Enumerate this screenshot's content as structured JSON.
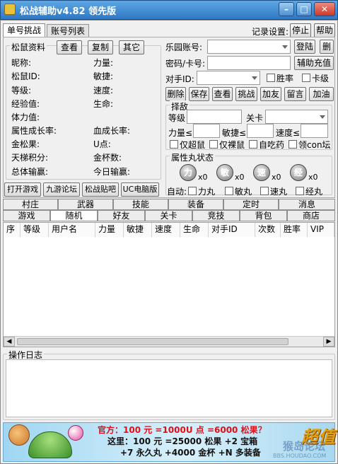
{
  "window": {
    "title": "松战辅助v4.82 领先版",
    "min": "–",
    "max": "□",
    "close": "✕"
  },
  "top_tabs": [
    {
      "label": "单号挑战"
    },
    {
      "label": "账号列表"
    }
  ],
  "record": {
    "label": "记录设置:",
    "stop": "停止",
    "help": "帮助"
  },
  "profile": {
    "group_label": "松鼠资料",
    "view": "查看",
    "copy": "复制",
    "other": "其它",
    "left_fields": [
      "昵称:",
      "松鼠ID:",
      "等级:",
      "经验值:",
      "体力值:",
      "属性成长率:",
      "金松果:",
      "天梯积分:",
      "总体输赢:"
    ],
    "right_fields": [
      "力量:",
      "敏捷:",
      "速度:",
      "生命:",
      "",
      "血成长率:",
      "U点:",
      "金杯数:",
      "今日输赢:"
    ]
  },
  "bottom_buttons": [
    "打开游戏",
    "九游论坛",
    "松战贴吧",
    "UC电脑版"
  ],
  "account": {
    "park_label": "乐园账号:",
    "login": "登陆",
    "delete": "删",
    "pwd_label": "密码/卡号:",
    "recharge": "辅助充值",
    "opponent_label": "对手ID:",
    "win_rate": "胜率",
    "card_level": "卡级"
  },
  "actions": [
    "删除",
    "保存",
    "查看",
    "挑战",
    "加友",
    "留言",
    "加油"
  ],
  "filter": {
    "group_label": "择敌",
    "level": "等级",
    "stage": "关卡",
    "power": "力量≤",
    "agility": "敏捷≤",
    "speed": "速度≤",
    "checks": [
      "仅超鼠",
      "仅裸鼠",
      "自吃药",
      "领con坛"
    ]
  },
  "pills": {
    "group_label": "属性丸状态",
    "items": [
      {
        "glyph": "力",
        "count": "x0"
      },
      {
        "glyph": "敏",
        "count": "x0"
      },
      {
        "glyph": "速",
        "count": "x0"
      },
      {
        "glyph": "经",
        "count": "x0"
      }
    ],
    "auto_label": "自动:",
    "auto_checks": [
      "力丸",
      "敏丸",
      "速丸",
      "经丸"
    ]
  },
  "tabs_row1": [
    "村庄",
    "武器",
    "技能",
    "装备",
    "定时",
    "消息"
  ],
  "tabs_row2": [
    "游戏",
    "随机",
    "好友",
    "关卡",
    "竞技",
    "背包",
    "商店"
  ],
  "table": {
    "columns": [
      "序",
      "等级",
      "用户名",
      "力量",
      "敏捷",
      "速度",
      "生命",
      "对手ID",
      "次数",
      "胜率",
      "VIP"
    ]
  },
  "log": {
    "label": "操作日志"
  },
  "ad": {
    "line1": "官方：100 元 =1000U 点 =6000 松果？",
    "line2": "这里：100 元 =25000 松果 +2 宝箱",
    "line3": "+7 永久丸 +4000 金杯 +N 多装备",
    "brand": "超值",
    "watermark": "BBS.HOUDAO.COM",
    "watermark2": "猴岛论坛"
  },
  "colors": {
    "title_bar": "#2f78c4",
    "ad_red": "#e0101a",
    "ad_bg": "#bfe3f6"
  }
}
